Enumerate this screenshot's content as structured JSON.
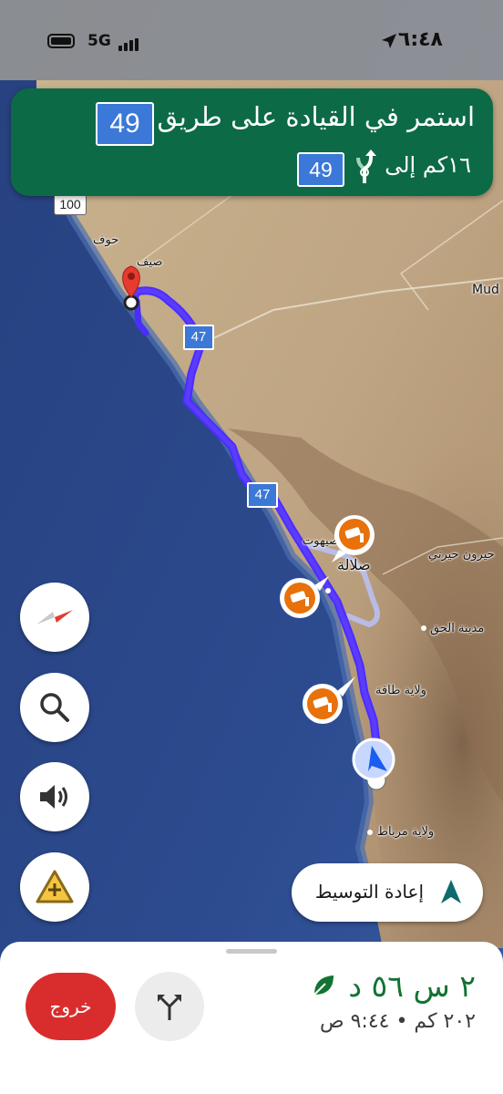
{
  "status_bar": {
    "network": "5G",
    "time": "٦:٤٨"
  },
  "banner": {
    "instruction": "استمر في القيادة على طريق",
    "route_shield": "49",
    "distance_text": "١٦كم إلى",
    "next_route_shield": "49"
  },
  "map": {
    "labels": {
      "huf": "حوف",
      "sayhut": "صيهوت",
      "salalah": "صلالة",
      "taqah": "ولاية طاقة",
      "mirbat": "ولاية مرباط",
      "madinat_alhaq": "مدينة الحق",
      "hairun": "حيرون حيرتي",
      "mud": "Mud",
      "sayhut_partial": "صيف"
    },
    "road_shields": {
      "r47_a": "47",
      "r47_b": "47",
      "r100": "100"
    }
  },
  "buttons": {
    "compass": "compass",
    "search": "search",
    "sound": "sound",
    "report": "report",
    "recenter_label": "إعادة التوسيط"
  },
  "bottom_sheet": {
    "eta_time": "٢ س ٥٦ د",
    "eta_details": "٢٠٢ كم • ٩:٤٤ ص",
    "exit_label": "خروج"
  },
  "colors": {
    "banner": "#0d6a46",
    "route": "#4a2dff",
    "exit": "#d92d2d",
    "eta": "#137333",
    "camera": "#e8710a"
  }
}
